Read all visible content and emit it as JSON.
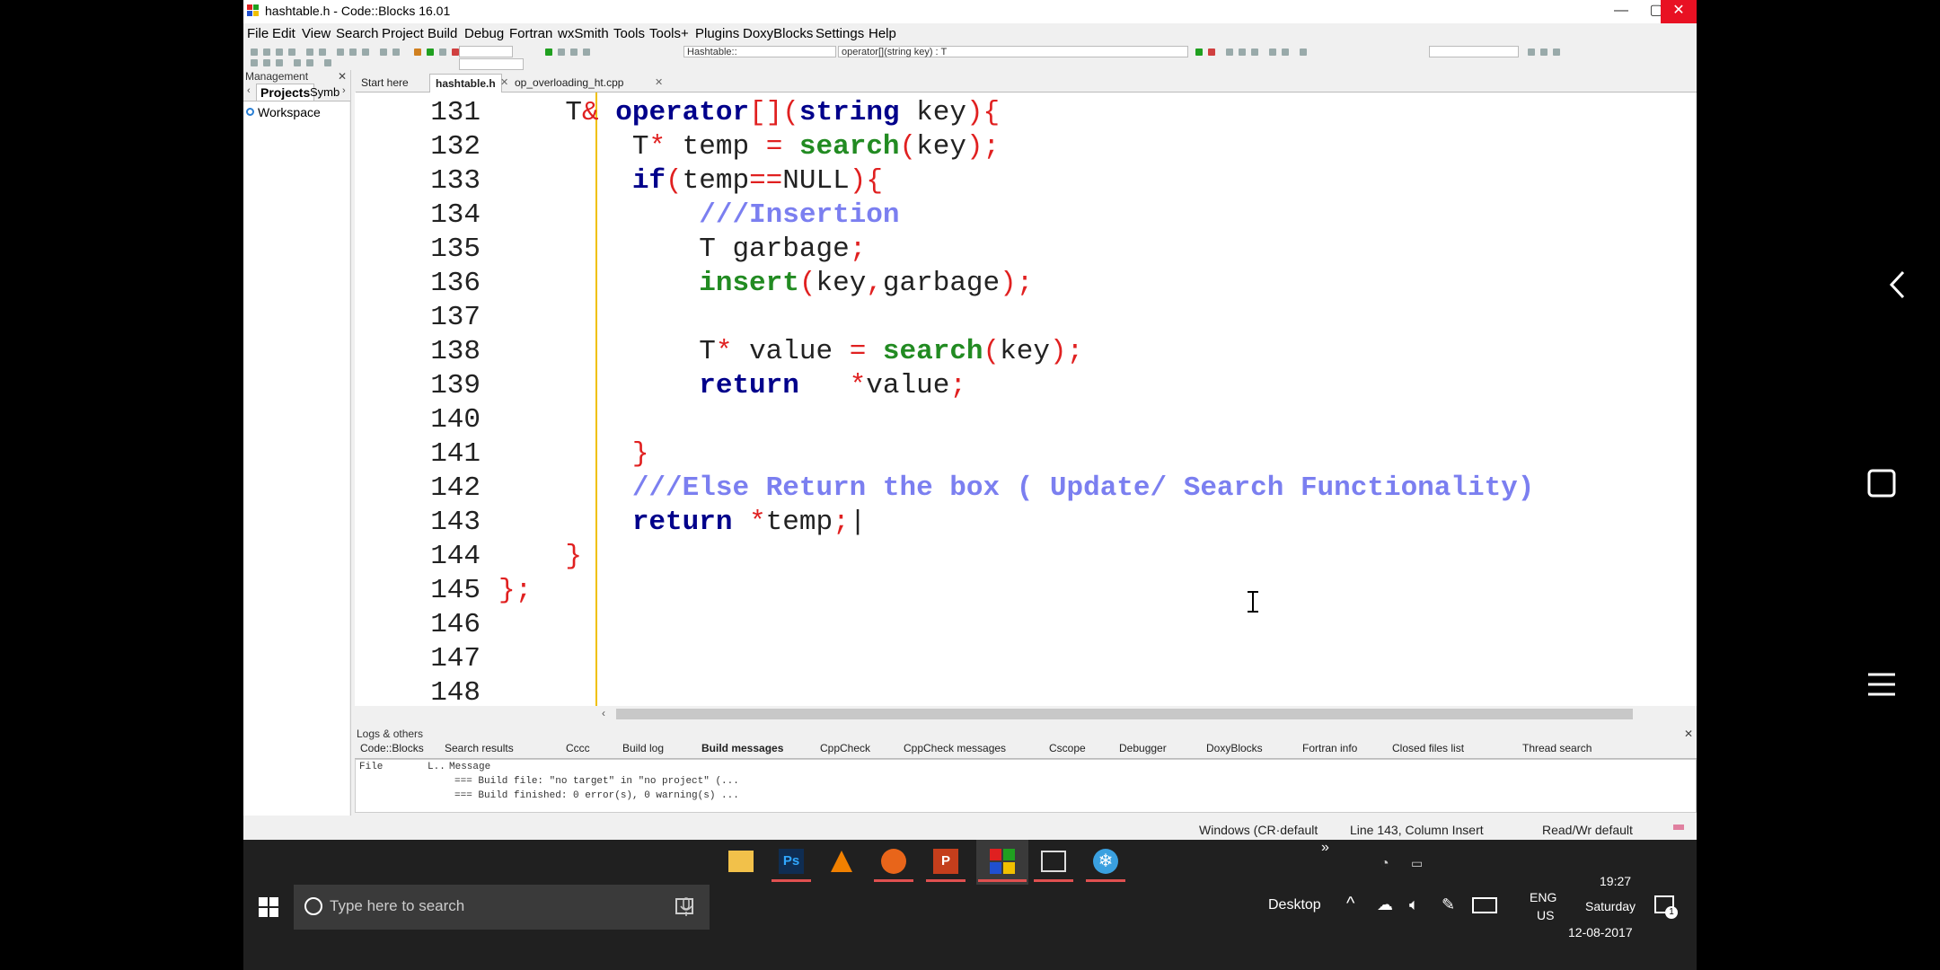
{
  "window": {
    "title": "hashtable.h - Code::Blocks 16.01",
    "minimize_glyph": "—",
    "maximize_glyph": "▢",
    "close_glyph": "✕"
  },
  "menu": [
    "File",
    "Edit",
    "View",
    "Search",
    "Project",
    "Build",
    "Debug",
    "Fortran",
    "wxSmith",
    "Tools",
    "Tools+",
    "Plugins",
    "DoxyBlocks",
    "Settings",
    "Help"
  ],
  "toolbar": {
    "scope_combo": "Hashtable::",
    "function_combo": "operator[](string key) : T"
  },
  "management": {
    "header": "Management",
    "tabs": [
      "Projects",
      "Symb"
    ],
    "tree_root": "Workspace"
  },
  "editor_tabs": [
    {
      "label": "Start here",
      "active": false
    },
    {
      "label": "hashtable.h",
      "active": true
    },
    {
      "label": "op_overloading_ht.cpp",
      "active": false
    }
  ],
  "code_lines": [
    {
      "n": "131",
      "html": "    <span class='id'>T</span><span class='op'>&amp;</span> <span class='kw'>operator</span><span class='op'>[]</span><span class='op'>(</span><span class='kw'>string</span> <span class='id'>key</span><span class='op'>){</span>"
    },
    {
      "n": "132",
      "html": "        <span class='id'>T</span><span class='op'>*</span> <span class='id'>temp</span> <span class='op'>=</span> <span class='fn'>search</span><span class='op'>(</span><span class='id'>key</span><span class='op'>);</span>"
    },
    {
      "n": "133",
      "html": "        <span class='kw'>if</span><span class='op'>(</span><span class='id'>temp</span><span class='op'>==</span><span class='id'>NULL</span><span class='op'>){</span>"
    },
    {
      "n": "134",
      "html": "            <span class='cm'>///Insertion</span>"
    },
    {
      "n": "135",
      "html": "            <span class='id'>T garbage</span><span class='op'>;</span>"
    },
    {
      "n": "136",
      "html": "            <span class='fn'>insert</span><span class='op'>(</span><span class='id'>key</span><span class='op'>,</span><span class='id'>garbage</span><span class='op'>);</span>"
    },
    {
      "n": "137",
      "html": ""
    },
    {
      "n": "138",
      "html": "            <span class='id'>T</span><span class='op'>*</span> <span class='id'>value</span> <span class='op'>=</span> <span class='fn'>search</span><span class='op'>(</span><span class='id'>key</span><span class='op'>);</span>"
    },
    {
      "n": "139",
      "html": "            <span class='kw'>return</span>   <span class='op'>*</span><span class='id'>value</span><span class='op'>;</span>"
    },
    {
      "n": "140",
      "html": ""
    },
    {
      "n": "141",
      "html": "        <span class='op'>}</span>"
    },
    {
      "n": "142",
      "html": "        <span class='cm'>///Else Return the box ( Update/ Search Functionality)</span>"
    },
    {
      "n": "143",
      "html": "        <span class='kw'>return</span> <span class='op'>*</span><span class='id'>temp</span><span class='op'>;</span><span class='id'>|</span>"
    },
    {
      "n": "144",
      "html": "    <span class='op'>}</span>"
    },
    {
      "n": "145",
      "html": "<span class='op'>};</span>"
    },
    {
      "n": "146",
      "html": ""
    },
    {
      "n": "147",
      "html": ""
    },
    {
      "n": "148",
      "html": ""
    }
  ],
  "logs": {
    "header": "Logs & others",
    "tabs": [
      "Code::Blocks",
      "Search results",
      "Cccc",
      "Build log",
      "Build messages",
      "CppCheck",
      "CppCheck messages",
      "Cscope",
      "Debugger",
      "DoxyBlocks",
      "Fortran info",
      "Closed files list",
      "Thread search"
    ],
    "active_tab": "Build messages",
    "columns": [
      "File",
      "L..",
      "Message"
    ],
    "rows": [
      "=== Build file: \"no target\" in \"no project\" (...",
      "=== Build finished: 0 error(s), 0 warning(s) ..."
    ]
  },
  "status": {
    "eol": "Windows (CR·default",
    "position": "Line 143, Column Insert",
    "mode": "Read/Wr default"
  },
  "taskbar": {
    "search_placeholder": "Type here to search",
    "desktop_label": "Desktop",
    "language_top": "ENG",
    "language_bottom": "US",
    "time": "19:27",
    "day": "Saturday",
    "date": "12-08-2017",
    "notification_count": "1",
    "overflow_glyph": "»"
  },
  "colors": {
    "keyword": "#00008b",
    "function": "#228b22",
    "operator": "#e02020",
    "comment": "#7b7ff0",
    "gutter_marker": "#f0c000",
    "close_button": "#e81123"
  }
}
